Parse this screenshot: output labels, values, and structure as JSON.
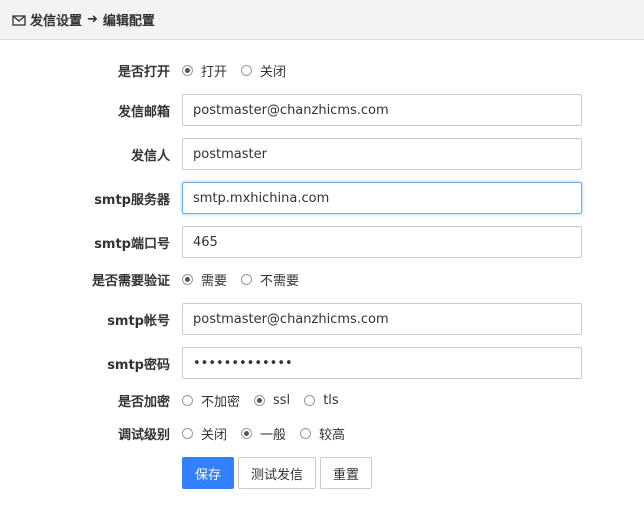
{
  "header": {
    "icon": "envelope-icon",
    "title": "发信设置",
    "arrow_icon": "arrow-right-icon",
    "subtitle": "编辑配置"
  },
  "form": {
    "turnon": {
      "label": "是否打开",
      "options": [
        {
          "label": "打开",
          "checked": true
        },
        {
          "label": "关闭",
          "checked": false
        }
      ]
    },
    "fromEmail": {
      "label": "发信邮箱",
      "value": "postmaster@chanzhicms.com"
    },
    "fromName": {
      "label": "发信人",
      "value": "postmaster"
    },
    "host": {
      "label": "smtp服务器",
      "value": "smtp.mxhichina.com"
    },
    "port": {
      "label": "smtp端口号",
      "value": "465"
    },
    "auth": {
      "label": "是否需要验证",
      "options": [
        {
          "label": "需要",
          "checked": true
        },
        {
          "label": "不需要",
          "checked": false
        }
      ]
    },
    "username": {
      "label": "smtp帐号",
      "value": "postmaster@chanzhicms.com"
    },
    "password": {
      "label": "smtp密码",
      "value": "•••••••••••••"
    },
    "secure": {
      "label": "是否加密",
      "options": [
        {
          "label": "不加密",
          "checked": false
        },
        {
          "label": "ssl",
          "checked": true
        },
        {
          "label": "tls",
          "checked": false
        }
      ]
    },
    "debug": {
      "label": "调试级别",
      "options": [
        {
          "label": "关闭",
          "checked": false
        },
        {
          "label": "一般",
          "checked": true
        },
        {
          "label": "较高",
          "checked": false
        }
      ]
    }
  },
  "buttons": {
    "save": "保存",
    "test": "测试发信",
    "reset": "重置"
  },
  "colors": {
    "primary": "#3280fc",
    "focus_border": "#66afe9",
    "header_bg": "#f3f3f3"
  }
}
